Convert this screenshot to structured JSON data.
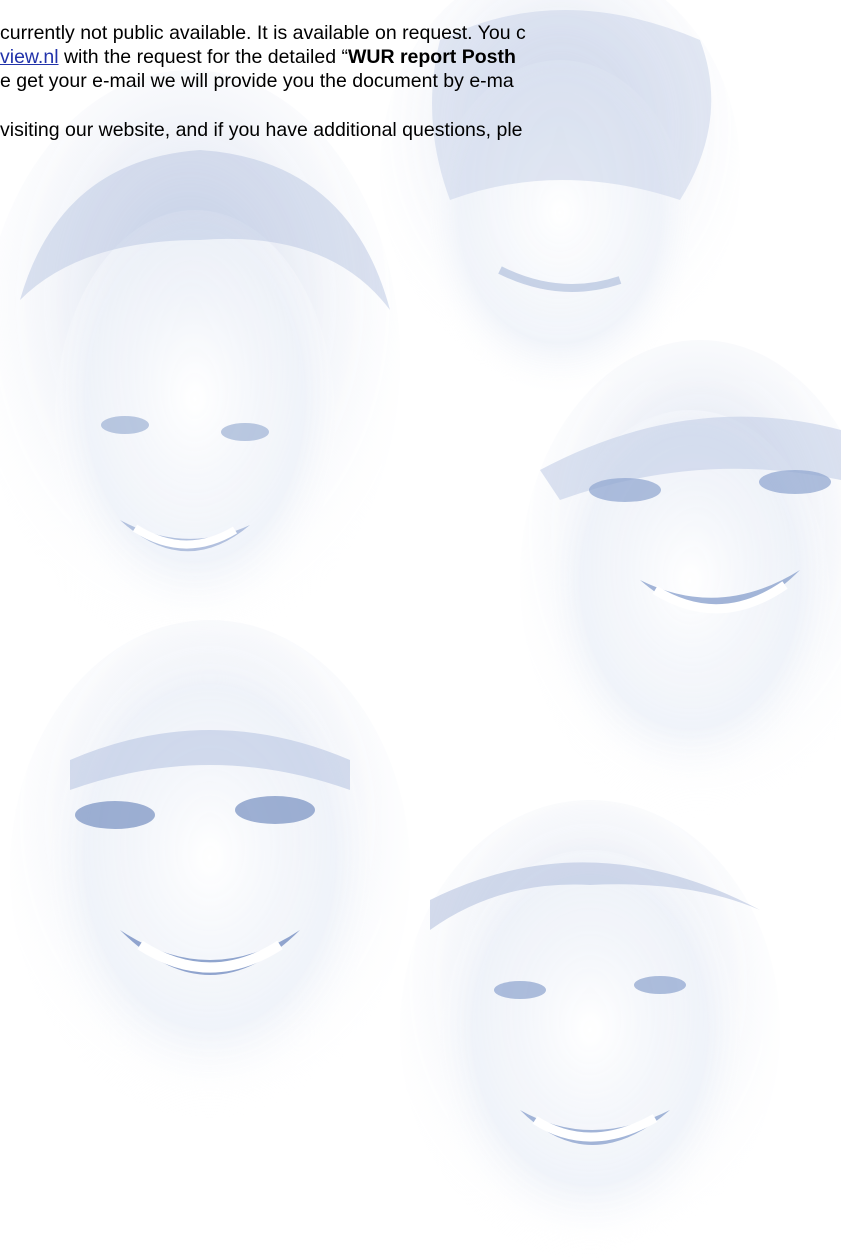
{
  "document": {
    "paragraph1": {
      "line1": "currently not public available. It is available on request. You c",
      "line2": {
        "link": "view.nl",
        "text_before_bold": " with the request for the detailed “",
        "bold": "WUR report Posth"
      },
      "line3": "e get your e-mail we will provide you the document by e-ma"
    },
    "paragraph2": {
      "line1": "visiting our website, and if you have additional questions, ple"
    }
  },
  "colors": {
    "text": "#000000",
    "link": "#2233aa",
    "face_tint": "#c9d4ea"
  }
}
